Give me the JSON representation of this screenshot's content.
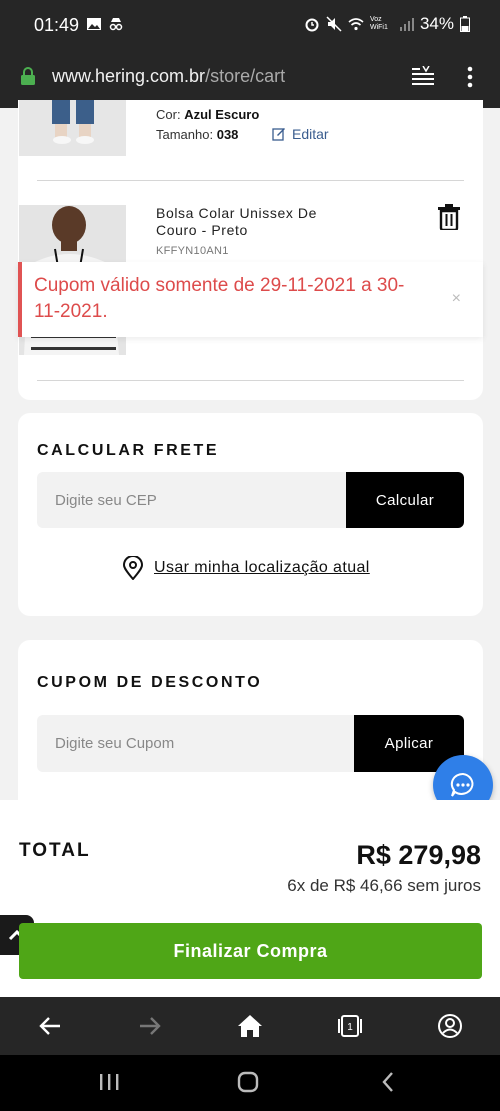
{
  "status_bar": {
    "time": "01:49",
    "wifi_label": "Voz WiFi1",
    "battery": "34%"
  },
  "browser": {
    "url_domain": "www.hering.com.br",
    "url_path": "/store/cart"
  },
  "cart": {
    "items": [
      {
        "color_label": "Cor:",
        "color_value": "Azul Escuro",
        "size_label": "Tamanho:",
        "size_value": "038",
        "edit_label": "Editar"
      },
      {
        "name": "Bolsa Colar Unissex De Couro - Preto",
        "code": "KFFYN10AN1"
      }
    ]
  },
  "toast": {
    "message": "Cupom válido somente de 29-11-2021 a 30-11-2021.",
    "close": "×"
  },
  "frete": {
    "title": "CALCULAR FRETE",
    "placeholder": "Digite seu CEP",
    "button": "Calcular",
    "location_link": "Usar minha localização atual"
  },
  "cupom": {
    "title": "CUPOM DE DESCONTO",
    "placeholder": "Digite seu Cupom",
    "button": "Aplicar"
  },
  "summary": {
    "total_label": "TOTAL",
    "total_value": "R$ 279,98",
    "installments": "6x de R$ 46,66 sem juros",
    "checkout_button": "Finalizar Compra"
  },
  "colors": {
    "checkout_green": "#4fa617",
    "error_red": "#dd4b4b",
    "chat_blue": "#2f7fe8"
  }
}
